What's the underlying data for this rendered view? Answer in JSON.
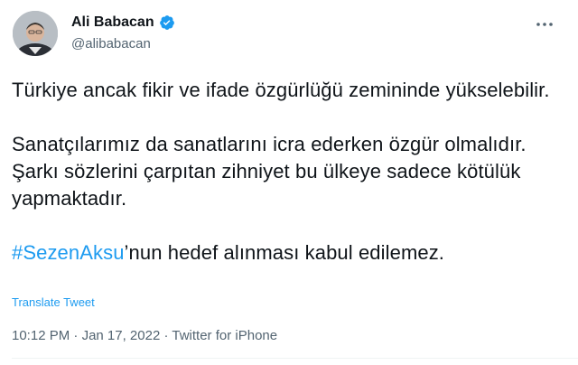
{
  "author": {
    "display_name": "Ali Babacan",
    "handle": "@alibabacan",
    "verified_icon": "verified-badge-icon",
    "verified_color": "#1d9bf0"
  },
  "menu": {
    "icon": "more-horizontal-icon"
  },
  "tweet": {
    "paragraph_1": "Türkiye ancak fikir ve ifade özgürlüğü zemininde yükselebilir.",
    "paragraph_2": "Sanatçılarımız da sanatlarını icra ederken özgür olmalıdır. Şarkı sözlerini çarpıtan zihniyet bu ülkeye sadece kötülük yapmaktadır.",
    "hashtag": "#SezenAksu",
    "paragraph_3_rest": "’nun hedef alınması kabul edilemez.",
    "link_color": "#1d9bf0"
  },
  "translate_label": "Translate Tweet",
  "meta": {
    "time": "10:12 PM",
    "separator": " · ",
    "date": "Jan 17, 2022",
    "source": "Twitter for iPhone"
  }
}
